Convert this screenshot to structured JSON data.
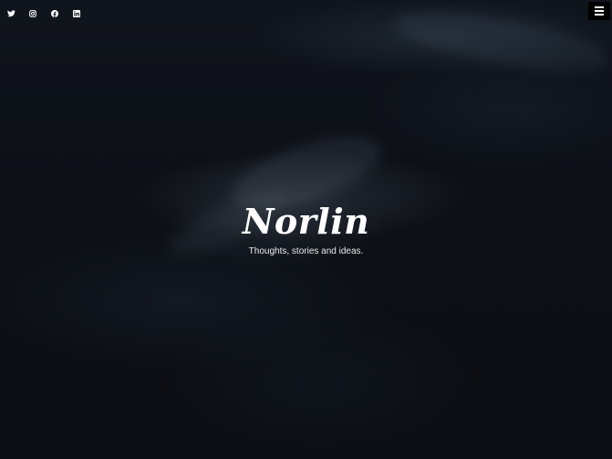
{
  "social": {
    "twitter": "twitter-icon",
    "instagram": "instagram-icon",
    "facebook": "facebook-icon",
    "linkedin": "linkedin-icon"
  },
  "menu": "hamburger-menu-icon",
  "hero": {
    "title": "Norlin",
    "tagline": "Thoughts, stories and ideas."
  },
  "colors": {
    "background": "#0b0c12",
    "text": "#ffffff"
  }
}
